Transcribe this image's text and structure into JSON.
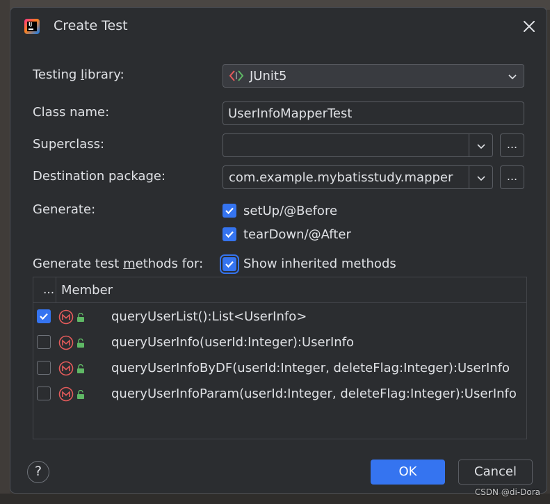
{
  "window": {
    "title": "Create Test",
    "watermark": "CSDN @di-Dora"
  },
  "form": {
    "testing_library": {
      "label_pre": "Testing ",
      "label_mnemonic": "l",
      "label_post": "ibrary:",
      "value": "JUnit5"
    },
    "class_name": {
      "label": "Class name:",
      "value": "UserInfoMapperTest"
    },
    "superclass": {
      "label": "Superclass:",
      "value": "",
      "browse": "..."
    },
    "destination_package": {
      "label": "Destination package:",
      "value": "com.example.mybatisstudy.mapper",
      "browse": "..."
    },
    "generate": {
      "label": "Generate:",
      "options": [
        {
          "label": "setUp/@Before",
          "checked": true
        },
        {
          "label": "tearDown/@After",
          "checked": true
        }
      ]
    },
    "methods_for": {
      "label_pre": "Generate test ",
      "label_mnemonic": "m",
      "label_post": "ethods for:",
      "show_inherited": {
        "label": "Show inherited methods",
        "checked": true
      }
    }
  },
  "members_table": {
    "header_select": "...",
    "header_member": "Member",
    "rows": [
      {
        "signature": "queryUserList():List<UserInfo>",
        "checked": true
      },
      {
        "signature": "queryUserInfo(userId:Integer):UserInfo",
        "checked": false
      },
      {
        "signature": "queryUserInfoByDF(userId:Integer, deleteFlag:Integer):UserInfo",
        "checked": false
      },
      {
        "signature": "queryUserInfoParam(userId:Integer, deleteFlag:Integer):UserInfo",
        "checked": false
      }
    ]
  },
  "buttons": {
    "help": "?",
    "ok": "OK",
    "cancel": "Cancel"
  },
  "icons": {
    "app": "intellij-idea-icon",
    "close": "close-icon",
    "junit": "junit-icon",
    "method": "method-icon",
    "lock": "public-lock-icon"
  },
  "colors": {
    "accent": "#3574f0",
    "dialog_bg": "#2b2d30",
    "method_icon": "#e55b5b",
    "lock_icon": "#5fb865"
  }
}
